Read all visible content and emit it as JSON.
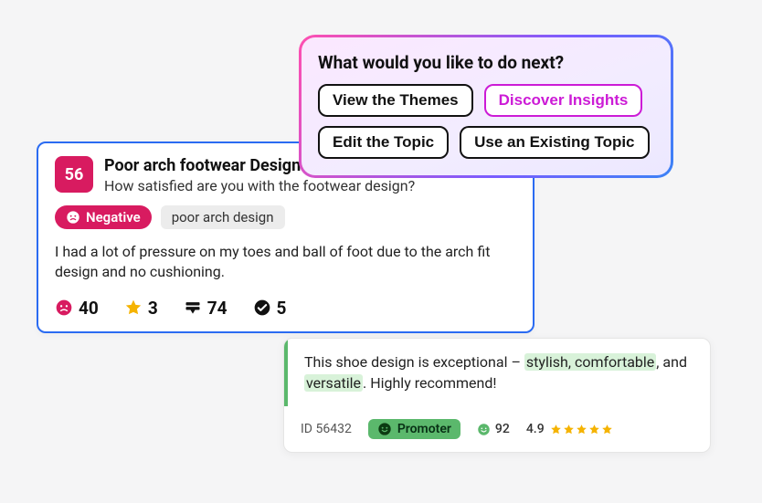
{
  "review": {
    "score": "56",
    "title": "Poor arch footwear Design",
    "subtitle": "How satisfied are you with the footwear design?",
    "sentiment_label": "Negative",
    "tag": "poor arch design",
    "body": "I had a lot of pressure on my toes and ball of foot due to the arch fit design and no cushioning.",
    "stats": {
      "frown": "40",
      "star": "3",
      "comments": "74",
      "check": "5"
    }
  },
  "prompt": {
    "title": "What would you like to do next?",
    "buttons": {
      "themes": "View the Themes",
      "insights": "Discover Insights",
      "edit": "Edit the Topic",
      "existing": "Use an Existing Topic"
    }
  },
  "quote": {
    "pre": "This shoe design is exceptional – ",
    "hl1": "stylish, comfortable",
    "mid": ", and ",
    "hl2": "versatile",
    "post": ". Highly recommend!",
    "id_label": "ID 56432",
    "promoter_label": "Promoter",
    "score": "92",
    "rating": "4.9"
  }
}
